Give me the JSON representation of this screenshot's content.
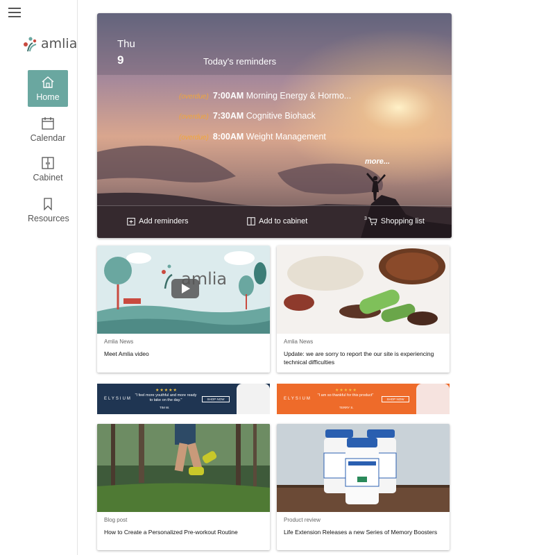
{
  "sidebar": {
    "logo_text": "amlia",
    "nav": [
      {
        "label": "Home",
        "icon": "home-icon",
        "active": true
      },
      {
        "label": "Calendar",
        "icon": "calendar-icon"
      },
      {
        "label": "Cabinet",
        "icon": "cabinet-icon"
      },
      {
        "label": "Resources",
        "icon": "bookmark-icon"
      }
    ],
    "accent": "#6aa7a0"
  },
  "hero": {
    "day": "Thu",
    "date": "9",
    "title": "Today's reminders",
    "reminders": [
      {
        "status": "(overdue)",
        "time": "7:00AM",
        "name": "Morning Energy & Hormo..."
      },
      {
        "status": "(overdue)",
        "time": "7:30AM",
        "name": "Cognitive Biohack"
      },
      {
        "status": "(overdue)",
        "time": "8:00AM",
        "name": "Weight Management"
      }
    ],
    "more": "more...",
    "actions": [
      {
        "label": "Add reminders",
        "icon": "add-reminder-icon"
      },
      {
        "label": "Add to cabinet",
        "icon": "cabinet-icon"
      },
      {
        "label": "Shopping list",
        "icon": "cart-icon",
        "badge": "3"
      }
    ],
    "overdue_color": "#f0a63a"
  },
  "cards": [
    {
      "category": "Amlia News",
      "title": "Meet Amlia video",
      "image_logo": "amlia"
    },
    {
      "category": "Amlia News",
      "title": "Update: we are sorry to report the our site is experiencing technical difficulties"
    },
    {
      "category": "Blog post",
      "title": "How to Create a Personalized Pre-workout Routine"
    },
    {
      "category": "Product review",
      "title": "Life Extension Releases a new Series of Memory Boosters"
    }
  ],
  "ads": [
    {
      "brand": "ELYSIUM",
      "stars": "★★★★★",
      "quote": "\"I feel more youthful and more ready to take on the day.\"",
      "author": "TIM W.",
      "cta": "SHOP NOW",
      "color": "#1f3552"
    },
    {
      "brand": "ELYSIUM",
      "stars": "★★★★★",
      "quote": "\"I am so thankful for this product\"",
      "author": "TERRY S.",
      "cta": "SHOP NOW",
      "color": "#ee6b2a"
    }
  ]
}
